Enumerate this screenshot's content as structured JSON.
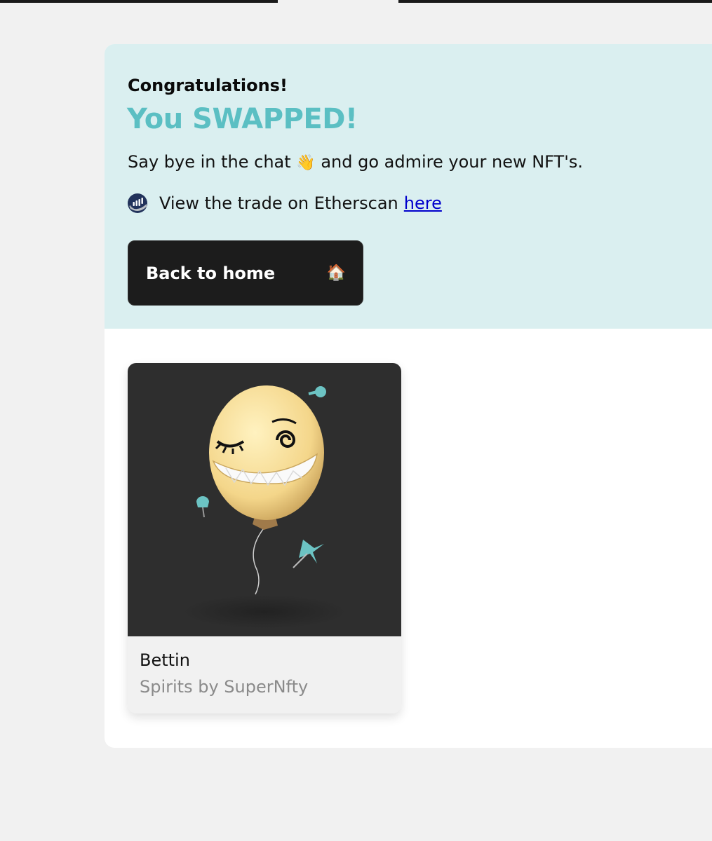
{
  "hero": {
    "congrats": "Congratulations!",
    "headline": "You SWAPPED!",
    "message_before": "Say bye in the chat",
    "wave_emoji": "👋",
    "message_after": "and go admire your new NFT's.",
    "etherscan_text": "View the trade on Etherscan",
    "etherscan_link": "here",
    "back_button": "Back to home",
    "home_emoji": "🏠"
  },
  "nft_card": {
    "name": "Bettin",
    "collection": "Spirits by SuperNfty",
    "icon": "smiling-balloon-face"
  },
  "colors": {
    "accent": "#5bbfc3",
    "hero_bg": "#daeff0",
    "button_bg": "#1c1c1c",
    "link": "#0000cc",
    "card_image_bg": "#2e2e2e"
  }
}
